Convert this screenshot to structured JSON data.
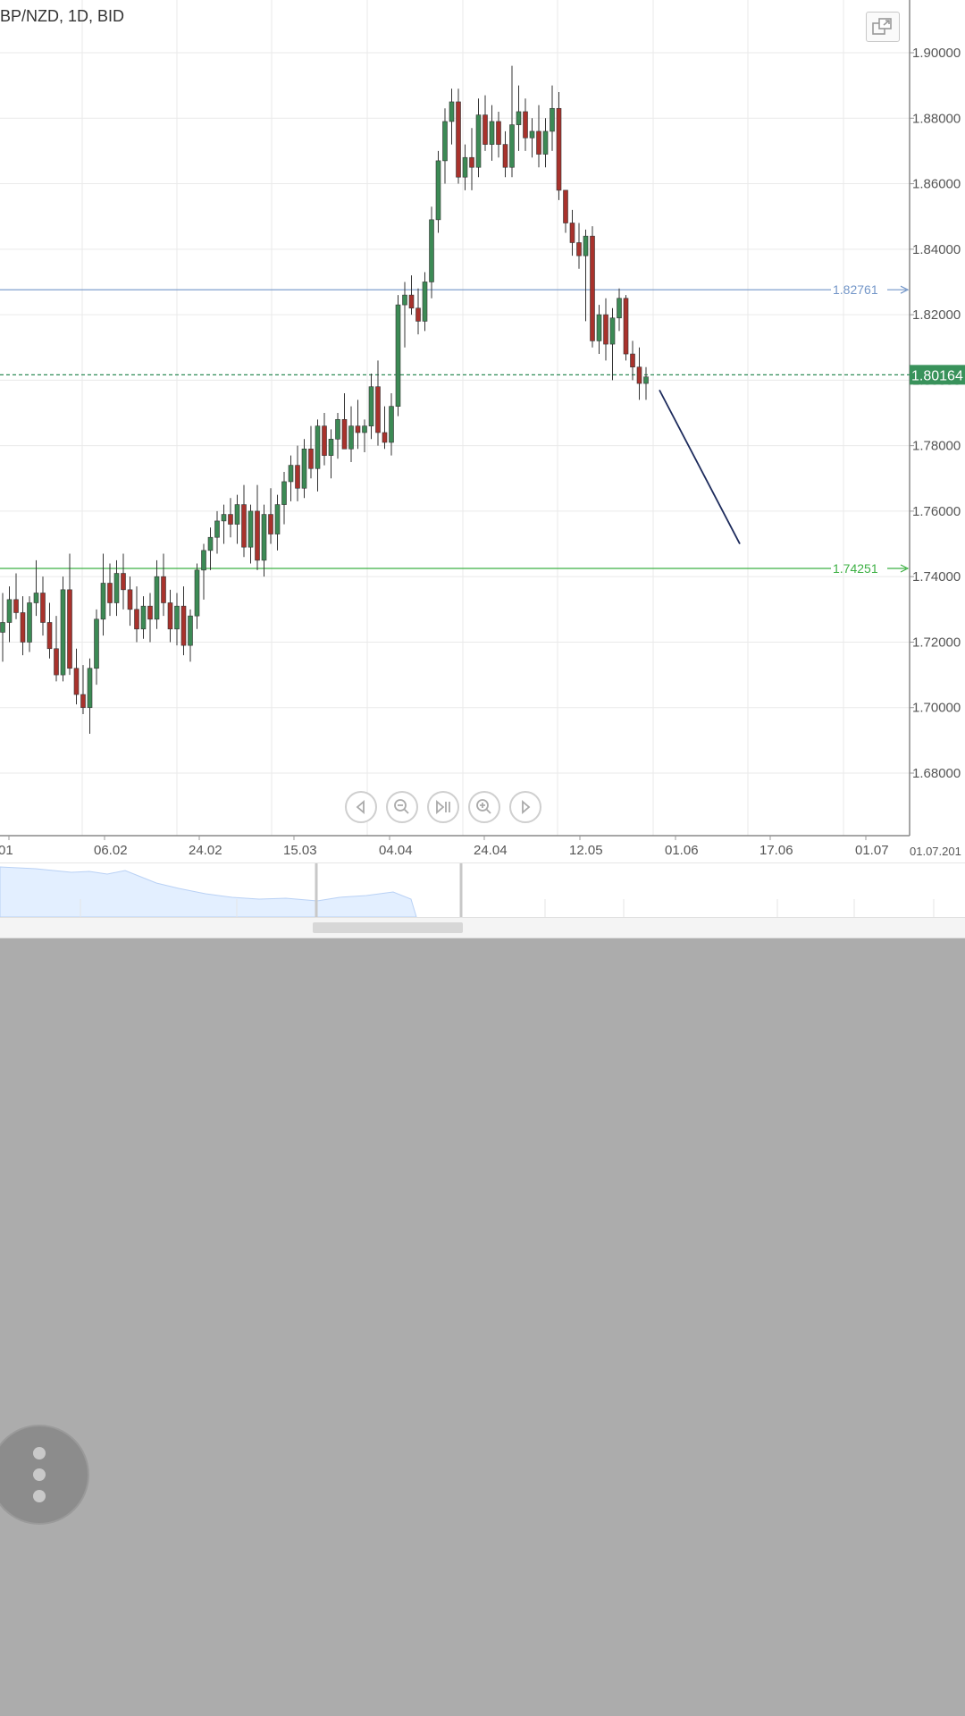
{
  "header": {
    "title": "BP/NZD, 1D, BID"
  },
  "chart_data": {
    "type": "candlestick",
    "title": "BP/NZD, 1D, BID",
    "ylim": [
      1.66,
      1.915
    ],
    "y_ticks": [
      1.9,
      1.88,
      1.86,
      1.84,
      1.82,
      1.8,
      1.78,
      1.76,
      1.74,
      1.72,
      1.7,
      1.68
    ],
    "y_tick_labels": [
      "1.90000",
      "1.88000",
      "1.86000",
      "1.84000",
      "1.82000",
      "1.80000",
      "1.78000",
      "1.76000",
      "1.74000",
      "1.72000",
      "1.70000",
      "1.68000"
    ],
    "x_tick_labels": [
      "01",
      "06.02",
      "24.02",
      "15.03",
      "04.04",
      "24.04",
      "12.05",
      "01.06",
      "17.06",
      "01.07"
    ],
    "x_tick_label_right": "01.07.201",
    "grid": true,
    "candles": [
      [
        1.723,
        1.735,
        1.714,
        1.726
      ],
      [
        1.726,
        1.737,
        1.72,
        1.733
      ],
      [
        1.733,
        1.741,
        1.727,
        1.729
      ],
      [
        1.729,
        1.734,
        1.716,
        1.72
      ],
      [
        1.72,
        1.734,
        1.717,
        1.732
      ],
      [
        1.732,
        1.745,
        1.728,
        1.735
      ],
      [
        1.735,
        1.74,
        1.722,
        1.726
      ],
      [
        1.726,
        1.732,
        1.715,
        1.718
      ],
      [
        1.718,
        1.728,
        1.708,
        1.71
      ],
      [
        1.71,
        1.74,
        1.708,
        1.736
      ],
      [
        1.736,
        1.747,
        1.71,
        1.712
      ],
      [
        1.712,
        1.718,
        1.701,
        1.704
      ],
      [
        1.704,
        1.713,
        1.698,
        1.7
      ],
      [
        1.7,
        1.715,
        1.692,
        1.712
      ],
      [
        1.712,
        1.73,
        1.707,
        1.727
      ],
      [
        1.727,
        1.747,
        1.722,
        1.738
      ],
      [
        1.738,
        1.744,
        1.728,
        1.732
      ],
      [
        1.732,
        1.745,
        1.728,
        1.741
      ],
      [
        1.741,
        1.747,
        1.73,
        1.736
      ],
      [
        1.736,
        1.74,
        1.725,
        1.73
      ],
      [
        1.73,
        1.737,
        1.72,
        1.724
      ],
      [
        1.724,
        1.734,
        1.721,
        1.731
      ],
      [
        1.731,
        1.735,
        1.72,
        1.727
      ],
      [
        1.727,
        1.745,
        1.724,
        1.74
      ],
      [
        1.74,
        1.747,
        1.728,
        1.732
      ],
      [
        1.732,
        1.736,
        1.72,
        1.724
      ],
      [
        1.724,
        1.735,
        1.719,
        1.731
      ],
      [
        1.731,
        1.737,
        1.716,
        1.719
      ],
      [
        1.719,
        1.73,
        1.714,
        1.728
      ],
      [
        1.728,
        1.744,
        1.724,
        1.742
      ],
      [
        1.742,
        1.75,
        1.733,
        1.748
      ],
      [
        1.748,
        1.755,
        1.742,
        1.752
      ],
      [
        1.752,
        1.76,
        1.747,
        1.757
      ],
      [
        1.757,
        1.762,
        1.75,
        1.759
      ],
      [
        1.759,
        1.764,
        1.752,
        1.756
      ],
      [
        1.756,
        1.765,
        1.75,
        1.762
      ],
      [
        1.762,
        1.768,
        1.746,
        1.749
      ],
      [
        1.749,
        1.762,
        1.744,
        1.76
      ],
      [
        1.76,
        1.768,
        1.742,
        1.745
      ],
      [
        1.745,
        1.762,
        1.74,
        1.759
      ],
      [
        1.759,
        1.767,
        1.75,
        1.753
      ],
      [
        1.753,
        1.765,
        1.748,
        1.762
      ],
      [
        1.762,
        1.772,
        1.756,
        1.769
      ],
      [
        1.769,
        1.777,
        1.763,
        1.774
      ],
      [
        1.774,
        1.78,
        1.763,
        1.767
      ],
      [
        1.767,
        1.782,
        1.764,
        1.779
      ],
      [
        1.779,
        1.786,
        1.77,
        1.773
      ],
      [
        1.773,
        1.788,
        1.766,
        1.786
      ],
      [
        1.786,
        1.79,
        1.774,
        1.777
      ],
      [
        1.777,
        1.785,
        1.77,
        1.782
      ],
      [
        1.782,
        1.79,
        1.776,
        1.788
      ],
      [
        1.788,
        1.796,
        1.782,
        1.779
      ],
      [
        1.779,
        1.792,
        1.775,
        1.786
      ],
      [
        1.786,
        1.794,
        1.779,
        1.784
      ],
      [
        1.784,
        1.788,
        1.778,
        1.786
      ],
      [
        1.786,
        1.802,
        1.782,
        1.798
      ],
      [
        1.798,
        1.806,
        1.78,
        1.784
      ],
      [
        1.784,
        1.792,
        1.779,
        1.781
      ],
      [
        1.781,
        1.796,
        1.777,
        1.792
      ],
      [
        1.792,
        1.826,
        1.789,
        1.823
      ],
      [
        1.823,
        1.83,
        1.81,
        1.826
      ],
      [
        1.826,
        1.832,
        1.82,
        1.822
      ],
      [
        1.822,
        1.828,
        1.814,
        1.818
      ],
      [
        1.818,
        1.833,
        1.815,
        1.83
      ],
      [
        1.83,
        1.853,
        1.825,
        1.849
      ],
      [
        1.849,
        1.87,
        1.845,
        1.867
      ],
      [
        1.867,
        1.883,
        1.86,
        1.879
      ],
      [
        1.879,
        1.889,
        1.872,
        1.885
      ],
      [
        1.885,
        1.889,
        1.86,
        1.862
      ],
      [
        1.862,
        1.872,
        1.858,
        1.868
      ],
      [
        1.868,
        1.877,
        1.858,
        1.865
      ],
      [
        1.865,
        1.886,
        1.862,
        1.881
      ],
      [
        1.881,
        1.887,
        1.87,
        1.872
      ],
      [
        1.872,
        1.884,
        1.867,
        1.879
      ],
      [
        1.879,
        1.882,
        1.868,
        1.872
      ],
      [
        1.872,
        1.876,
        1.862,
        1.865
      ],
      [
        1.865,
        1.896,
        1.862,
        1.878
      ],
      [
        1.878,
        1.89,
        1.87,
        1.882
      ],
      [
        1.882,
        1.886,
        1.87,
        1.874
      ],
      [
        1.874,
        1.88,
        1.868,
        1.876
      ],
      [
        1.876,
        1.884,
        1.865,
        1.869
      ],
      [
        1.869,
        1.88,
        1.865,
        1.876
      ],
      [
        1.876,
        1.89,
        1.87,
        1.883
      ],
      [
        1.883,
        1.888,
        1.855,
        1.858
      ],
      [
        1.858,
        1.856,
        1.845,
        1.848
      ],
      [
        1.848,
        1.852,
        1.838,
        1.842
      ],
      [
        1.842,
        1.848,
        1.834,
        1.838
      ],
      [
        1.838,
        1.846,
        1.818,
        1.844
      ],
      [
        1.844,
        1.847,
        1.81,
        1.812
      ],
      [
        1.812,
        1.823,
        1.808,
        1.82
      ],
      [
        1.82,
        1.825,
        1.806,
        1.811
      ],
      [
        1.811,
        1.822,
        1.8,
        1.819
      ],
      [
        1.819,
        1.828,
        1.815,
        1.825
      ],
      [
        1.825,
        1.826,
        1.806,
        1.808
      ],
      [
        1.808,
        1.812,
        1.8,
        1.804
      ],
      [
        1.804,
        1.81,
        1.794,
        1.799
      ],
      [
        1.799,
        1.804,
        1.794,
        1.801
      ]
    ],
    "horizontal_lines": [
      {
        "value": 1.82761,
        "label": "1.82761",
        "color": "#7396c8"
      },
      {
        "value": 1.74251,
        "label": "1.74251",
        "color": "#3cb043"
      },
      {
        "value": 1.80164,
        "label": "1.80164",
        "color": "#2e8b57",
        "style": "dashed"
      }
    ],
    "current_price": {
      "value": 1.80164,
      "label": "1.80164",
      "color": "#39925b"
    },
    "trend_line": {
      "start": [
        98,
        1.797
      ],
      "end": [
        110,
        1.75
      ],
      "color": "#1d2b5c"
    },
    "colors": {
      "up": "#3c8a55",
      "down": "#a8322c",
      "grid": "#eaeaea"
    }
  },
  "controls": {
    "nav": [
      "scroll-left-icon",
      "zoom-out-icon",
      "reset-view-icon",
      "zoom-in-icon",
      "scroll-right-icon"
    ],
    "popout": "popout-icon"
  },
  "fab": {
    "icon": "more-vertical-icon"
  }
}
